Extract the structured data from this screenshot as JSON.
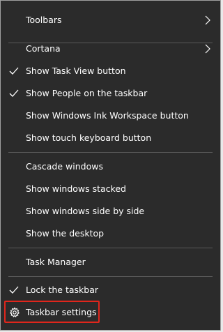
{
  "menu": {
    "items": [
      {
        "label": "Toolbars",
        "checked": false,
        "submenu": true
      },
      {
        "label": "Cortana",
        "checked": false,
        "submenu": true
      },
      {
        "label": "Show Task View button",
        "checked": true,
        "submenu": false
      },
      {
        "label": "Show People on the taskbar",
        "checked": true,
        "submenu": false
      },
      {
        "label": "Show Windows Ink Workspace button",
        "checked": false,
        "submenu": false
      },
      {
        "label": "Show touch keyboard button",
        "checked": false,
        "submenu": false
      },
      {
        "label": "Cascade windows",
        "checked": false,
        "submenu": false
      },
      {
        "label": "Show windows stacked",
        "checked": false,
        "submenu": false
      },
      {
        "label": "Show windows side by side",
        "checked": false,
        "submenu": false
      },
      {
        "label": "Show the desktop",
        "checked": false,
        "submenu": false
      },
      {
        "label": "Task Manager",
        "checked": false,
        "submenu": false
      },
      {
        "label": "Lock the taskbar",
        "checked": true,
        "submenu": false
      },
      {
        "label": "Taskbar settings",
        "checked": false,
        "submenu": false,
        "icon": "gear-icon",
        "highlighted": true
      }
    ]
  },
  "colors": {
    "menu_background": "#2b2b2b",
    "text": "#ffffff",
    "separator": "#5a5a5a",
    "highlight_border": "#e0261c"
  }
}
